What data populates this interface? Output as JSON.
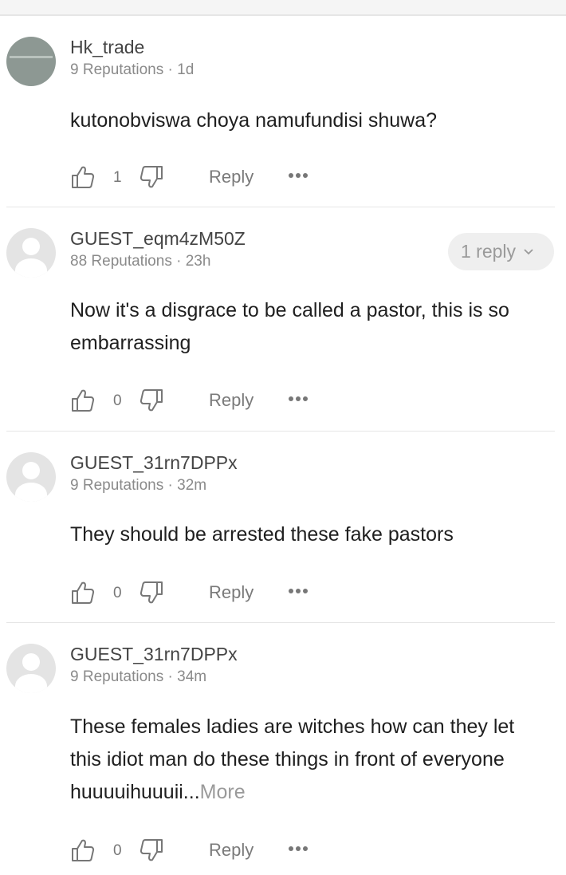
{
  "comments": [
    {
      "username": "Hk_trade",
      "meta": "9 Reputations · 1d",
      "body": "kutonobviswa choya namufundisi shuwa?",
      "more": "",
      "likes": "1",
      "reply_label": "Reply",
      "replies_label": ""
    },
    {
      "username": "GUEST_eqm4zM50Z",
      "meta": "88 Reputations · 23h",
      "body": "Now it's a disgrace to be called a pastor, this is so embarrassing",
      "more": "",
      "likes": "0",
      "reply_label": "Reply",
      "replies_label": "1 reply"
    },
    {
      "username": "GUEST_31rn7DPPx",
      "meta": "9 Reputations · 32m",
      "body": "They should be arrested these fake pastors",
      "more": "",
      "likes": "0",
      "reply_label": "Reply",
      "replies_label": ""
    },
    {
      "username": "GUEST_31rn7DPPx",
      "meta": "9 Reputations · 34m",
      "body": "These females ladies are witches how can they let this idiot man do these things in front of everyone huuuuihuuuii...",
      "more": "More",
      "likes": "0",
      "reply_label": "Reply",
      "replies_label": ""
    }
  ],
  "icons": {
    "like": "thumbs-up-icon",
    "dislike": "thumbs-down-icon",
    "more": "more-dots-icon",
    "expand": "chevron-down-icon",
    "avatar": "user-avatar"
  },
  "colors": {
    "text": "#1f1f1f",
    "secondary": "#8a8a8a",
    "icon": "#777777",
    "pill_bg": "#efefef",
    "divider": "#e6e6e6"
  }
}
